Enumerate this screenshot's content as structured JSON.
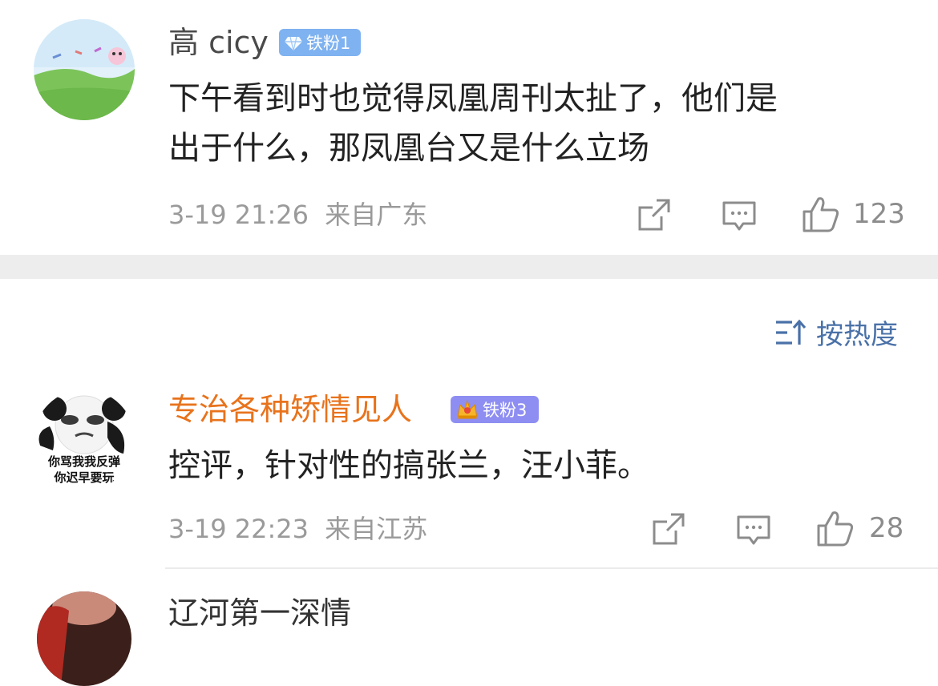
{
  "comments": [
    {
      "username": "高 cicy",
      "badge": "铁粉1",
      "text_lines": [
        "下午看到时也觉得凤凰周刊太扯了，他们是",
        "出于什么，那凤凰台又是什么立场"
      ],
      "time": "3-19 21:26",
      "location": "来自广东",
      "likes": "123"
    },
    {
      "username": "专治各种矫情见人",
      "badge": "铁粉3",
      "avatar_text_1": "你骂我我反弹",
      "avatar_text_2": "你迟早要玩",
      "text": "控评，针对性的搞张兰，汪小菲。",
      "time": "3-19 22:23",
      "location": "来自江苏",
      "likes": "28"
    },
    {
      "username": "辽河第一深情"
    }
  ],
  "sort": {
    "label": "按热度"
  },
  "colors": {
    "badge_blue": "#7fb2f0",
    "badge_purple": "#8e8ef2",
    "username_orange": "#e8731c",
    "sort_blue": "#4a71a8"
  },
  "icons": [
    "share-icon",
    "comment-icon",
    "like-icon",
    "sort-icon",
    "diamond-icon",
    "crown-icon"
  ]
}
